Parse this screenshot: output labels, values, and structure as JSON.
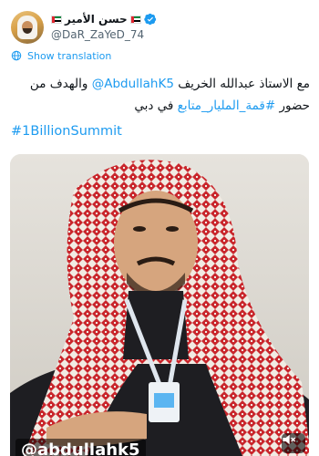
{
  "author": {
    "display_name": "حسن الأمير",
    "handle": "@DaR_ZaYeD_74",
    "verified": true
  },
  "translate": {
    "label": "Show translation"
  },
  "tweet": {
    "line1_prefix": "مع الاستاذ عبدالله الخريف ",
    "mention": "@AbdullahK5",
    "line1_suffix": " والهدف من",
    "line2_prefix": "حضور ",
    "hashtag_ar": "#قمة_المليار_متابع",
    "line2_suffix": " في دبي",
    "hashtag_en": "#1BillionSummit"
  },
  "media": {
    "watermark": "@abdullahk5",
    "mute_icon": "speaker-muted-icon"
  },
  "colors": {
    "link": "#1d9bf0",
    "text": "#0f1419",
    "muted": "#536471",
    "verified": "#1d9bf0"
  }
}
